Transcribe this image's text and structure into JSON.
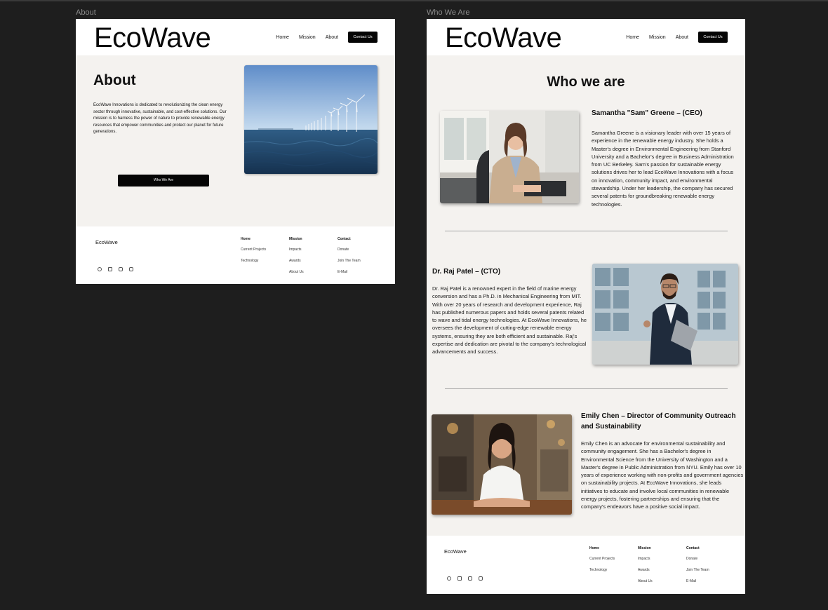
{
  "frames": {
    "about_label": "About",
    "who_label": "Who We Are"
  },
  "header": {
    "logo": "EcoWave",
    "nav": [
      "Home",
      "Mission",
      "About"
    ],
    "contact_button": "Contact Us"
  },
  "about": {
    "title": "About",
    "text": "EcoWave Innovations is dedicated to revolutionizing the clean energy sector through innovative, sustainable, and cost-effective solutions. Our mission is to harness the power of nature to provide renewable energy resources that empower communities and protect our planet for future generations.",
    "button": "Who We Are"
  },
  "who": {
    "title": "Who we are",
    "people": [
      {
        "name": "Samantha \"Sam\" Greene – (CEO)",
        "bio": "Samantha Greene is a visionary leader with over 15 years of experience in the renewable energy industry. She holds a Master's degree in Environmental Engineering from Stanford University and a Bachelor's degree in Business Administration from UC Berkeley. Sam's passion for sustainable energy solutions drives her to lead EcoWave Innovations with a focus on innovation, community impact, and environmental stewardship. Under her leadership, the company has secured several patents for groundbreaking renewable energy technologies."
      },
      {
        "name": "Dr. Raj Patel – (CTO)",
        "bio": "Dr. Raj Patel is a renowned expert in the field of marine energy conversion and has a Ph.D. in Mechanical Engineering from MIT. With over 20 years of research and development experience, Raj has published numerous papers and holds several patents related to wave and tidal energy technologies. At EcoWave Innovations, he oversees the development of cutting-edge renewable energy systems, ensuring they are both efficient and sustainable. Raj's expertise and dedication are pivotal to the company's technological advancements and success."
      },
      {
        "name": "Emily Chen – Director of Community Outreach and Sustainability",
        "bio": "Emily Chen is an advocate for environmental sustainability and community engagement. She has a Bachelor's degree in Environmental Science from the University of Washington and a Master's degree in Public Administration from NYU. Emily has over 10 years of experience working with non-profits and government agencies on sustainability projects. At EcoWave Innovations, she leads initiatives to educate and involve local communities in renewable energy projects, fostering partnerships and ensuring that the company's endeavors have a positive social impact."
      }
    ]
  },
  "footer": {
    "logo": "EcoWave",
    "columns": [
      {
        "heading": "Home",
        "links": [
          "Current Projects",
          "Technology"
        ]
      },
      {
        "heading": "Mission",
        "links": [
          "Impacts",
          "Awards",
          "About Us"
        ]
      },
      {
        "heading": "Contact",
        "links": [
          "Donate",
          "Join The Team",
          "E-Mail"
        ]
      }
    ],
    "social_icons": [
      "facebook-icon",
      "linkedin-icon",
      "youtube-icon",
      "instagram-icon"
    ]
  },
  "colors": {
    "page_bg": "#f4f2ef",
    "canvas_bg": "#1e1e1e",
    "button_bg": "#050505"
  }
}
